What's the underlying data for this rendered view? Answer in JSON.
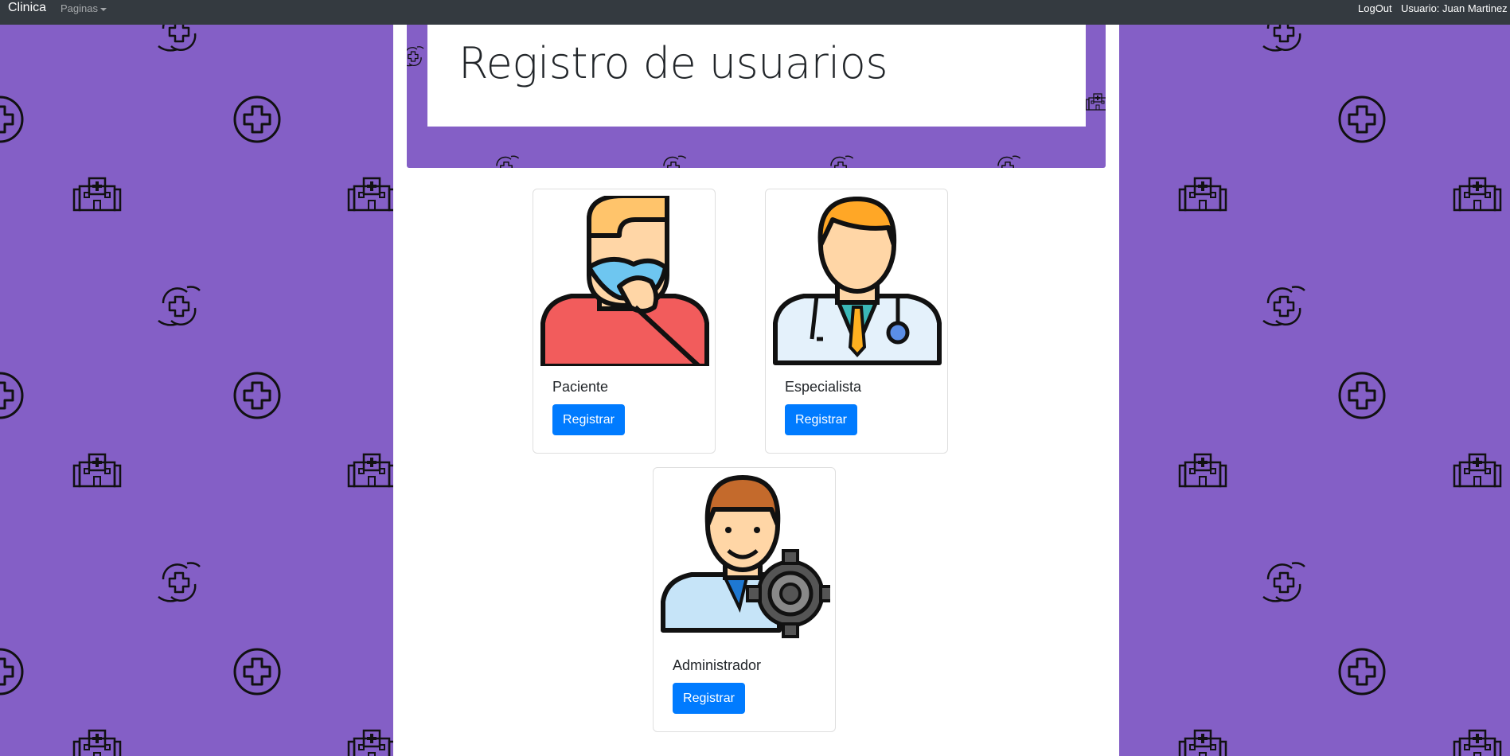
{
  "navbar": {
    "brand": "Clinica",
    "menu_label": "Paginas",
    "logout_label": "LogOut",
    "user_label": "Usuario: Juan Martinez"
  },
  "header": {
    "title": "Registro de usuarios"
  },
  "cards": [
    {
      "name": "paciente",
      "label": "Paciente",
      "button": "Registrar"
    },
    {
      "name": "especialista",
      "label": "Especialista",
      "button": "Registrar"
    },
    {
      "name": "administrador",
      "label": "Administrador",
      "button": "Registrar"
    }
  ],
  "colors": {
    "background": "#845fc6",
    "navbar": "#343a40",
    "primary": "#007bff"
  }
}
